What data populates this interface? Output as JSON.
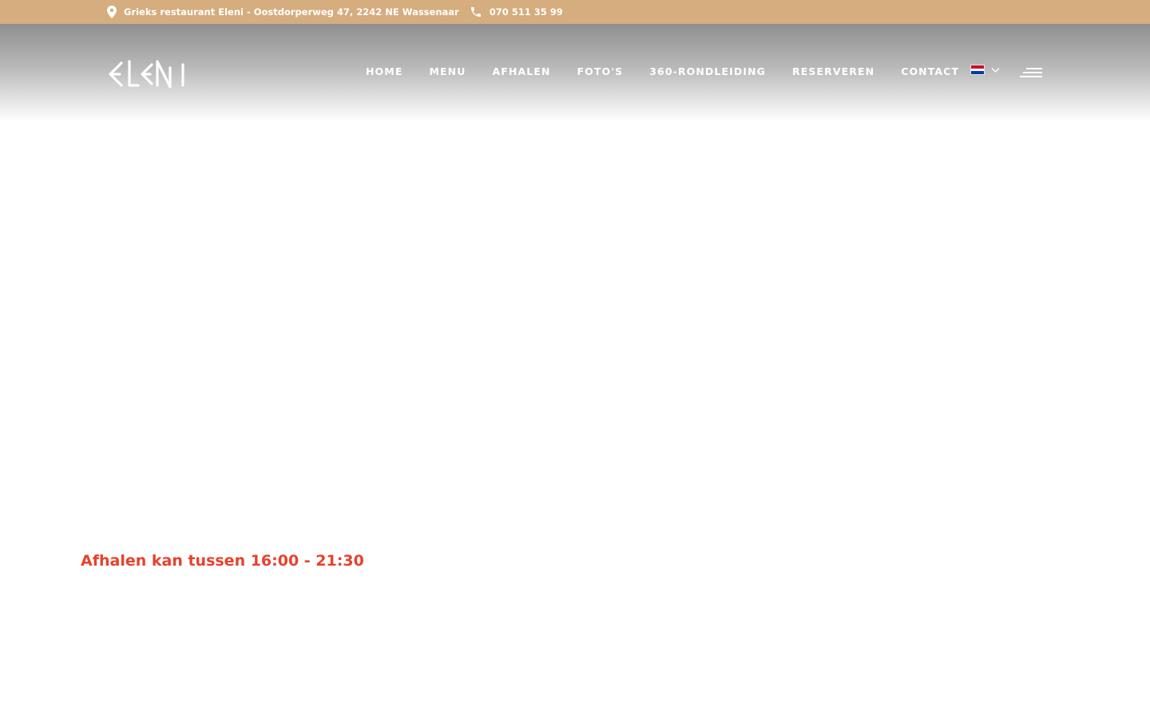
{
  "topbar": {
    "address": "Grieks restaurant Eleni - Oostdorperweg 47, 2242 NE Wassenaar",
    "phone": "070 511 35 99",
    "background_color": "#d5ad7e"
  },
  "header": {
    "logo_text": "ELENI",
    "nav": [
      {
        "label": "HOME"
      },
      {
        "label": "MENU"
      },
      {
        "label": "AFHALEN"
      },
      {
        "label": "FOTO'S"
      },
      {
        "label": "360-RONDLEIDING"
      },
      {
        "label": "RESERVEREN"
      },
      {
        "label": "CONTACT"
      }
    ],
    "language_icon": "netherlands-flag-icon",
    "menu_icon": "hamburger-menu-icon"
  },
  "content": {
    "pickup_notice": "Afhalen kan tussen 16:00 - 21:30",
    "notice_color": "#e8412c"
  }
}
